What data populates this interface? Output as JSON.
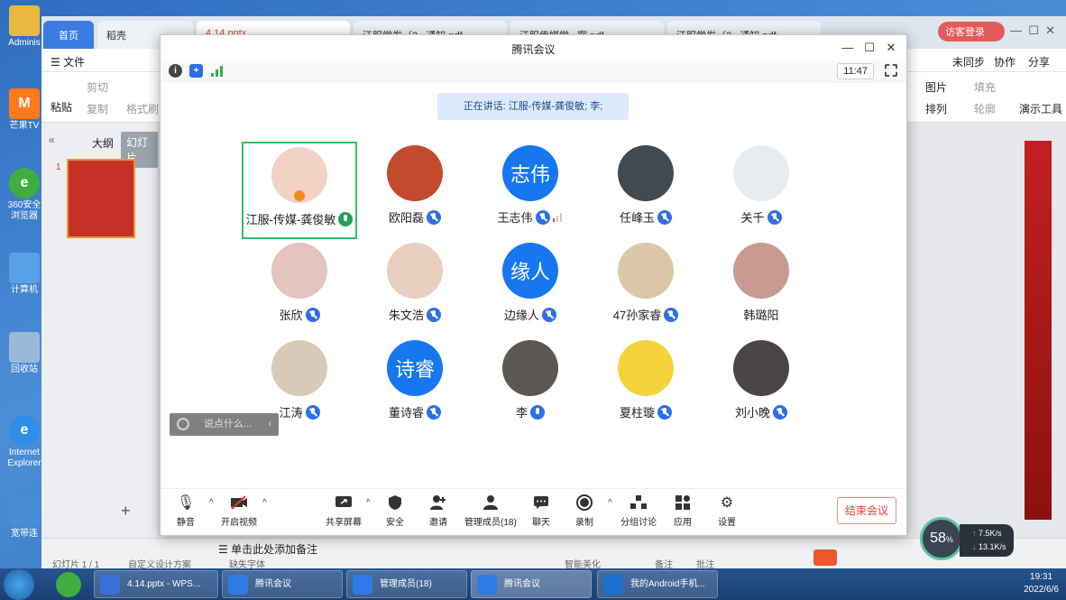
{
  "desktop": {
    "icons": [
      {
        "label": "Adminis",
        "color": "#e8b840"
      },
      {
        "label": "芒果TV",
        "color": "#ff7a1a"
      },
      {
        "label": "360安全浏览器",
        "color": "#3fae3f"
      },
      {
        "label": "计算机",
        "color": "#5aa0e6"
      },
      {
        "label": "回收站",
        "color": "#9ab8d8"
      },
      {
        "label": "Internet Explorer",
        "color": "#2f8ee6"
      },
      {
        "label": "宽带连",
        "color": "#4b8cd6"
      }
    ]
  },
  "wps": {
    "home_tab": "首页",
    "tabs": [
      "稻壳",
      "4.14.pptx",
      "江服学发〔2...通知.pdf",
      "江服传媒学...案.pdf",
      "江服学发〔2...通知.pdf"
    ],
    "login": "访客登录",
    "menu_file": "文件",
    "menu_right": [
      "未同步",
      "协作",
      "分享"
    ],
    "ribbon_left": [
      "粘贴",
      "剪切",
      "复制",
      "格式刷"
    ],
    "ribbon_right": [
      "图片",
      "填充",
      "排列",
      "轮廓",
      "演示工具"
    ],
    "panel_tabs": [
      "大纲",
      "幻灯片"
    ],
    "slide_number": "1",
    "notes_placeholder": "单击此处添加备注",
    "status": [
      "幻灯片 1 / 1",
      "自定义设计方案",
      "缺失字体",
      "智能美化",
      "备注",
      "批注"
    ]
  },
  "meeting": {
    "title": "腾讯会议",
    "clock": "11:47",
    "speaking": "正在讲话: 江服-传媒-龚俊敏; 李;",
    "participants": [
      {
        "name": "江服-传媒-龚俊敏",
        "avatar_text": "",
        "color": "#f1d2c4",
        "mic": "green",
        "selected": true,
        "host": true
      },
      {
        "name": "欧阳磊",
        "avatar_text": "",
        "color": "#c24a2d",
        "mic": "muted"
      },
      {
        "name": "王志伟",
        "avatar_text": "志伟",
        "color": "#1677f0",
        "mic": "muted",
        "signal": true
      },
      {
        "name": "任峰玉",
        "avatar_text": "",
        "color": "#3f4a53",
        "mic": "muted"
      },
      {
        "name": "关千",
        "avatar_text": "",
        "color": "#e9ecef",
        "mic": "muted"
      },
      {
        "name": "张欣",
        "avatar_text": "",
        "color": "#e4c4bd",
        "mic": "muted"
      },
      {
        "name": "朱文浩",
        "avatar_text": "",
        "color": "#e8cfc0",
        "mic": "muted"
      },
      {
        "name": "边缘人",
        "avatar_text": "缘人",
        "color": "#1677f0",
        "mic": "muted"
      },
      {
        "name": "47孙家睿",
        "avatar_text": "",
        "color": "#d9c7a8",
        "mic": "muted"
      },
      {
        "name": "韩璐阳",
        "avatar_text": "",
        "color": "#c99a91",
        "mic": "none"
      },
      {
        "name": "江涛",
        "avatar_text": "",
        "color": "#d9c9b9",
        "mic": "muted"
      },
      {
        "name": "董诗睿",
        "avatar_text": "诗睿",
        "color": "#1677f0",
        "mic": "muted"
      },
      {
        "name": "李",
        "avatar_text": "",
        "color": "#5b5753",
        "mic": "on"
      },
      {
        "name": "夏柱璇",
        "avatar_text": "",
        "color": "#f4d43a",
        "mic": "muted"
      },
      {
        "name": "刘小晚",
        "avatar_text": "",
        "color": "#4a4646",
        "mic": "muted"
      }
    ],
    "chat_placeholder": "说点什么...",
    "toolbar": [
      {
        "label": "静音",
        "icon": "mic-icon"
      },
      {
        "label": "开启视频",
        "icon": "video-off-icon"
      },
      {
        "label": "共享屏幕",
        "icon": "share-screen-icon"
      },
      {
        "label": "安全",
        "icon": "shield-icon"
      },
      {
        "label": "邀请",
        "icon": "invite-icon"
      },
      {
        "label": "管理成员(18)",
        "icon": "members-icon"
      },
      {
        "label": "聊天",
        "icon": "chat-icon"
      },
      {
        "label": "录制",
        "icon": "record-icon"
      },
      {
        "label": "分组讨论",
        "icon": "breakout-icon"
      },
      {
        "label": "应用",
        "icon": "apps-icon"
      },
      {
        "label": "设置",
        "icon": "settings-icon"
      }
    ],
    "end_button": "结束会议"
  },
  "net_widget": {
    "percent": "58",
    "percent_sign": "%",
    "up": "7.5",
    "up_unit": "K/s",
    "down": "13.1",
    "down_unit": "K/s"
  },
  "taskbar": {
    "buttons": [
      {
        "label": "4.14.pptx - WPS...",
        "color": "#3a6fd8"
      },
      {
        "label": "腾讯会议",
        "color": "#2f7ae5"
      },
      {
        "label": "管理成员(18)",
        "color": "#2f7ae5"
      },
      {
        "label": "腾讯会议",
        "color": "#2f7ae5"
      },
      {
        "label": "我的Android手机...",
        "color": "#1d6fd0"
      }
    ],
    "time": "19:31",
    "date": "2022/6/6"
  }
}
